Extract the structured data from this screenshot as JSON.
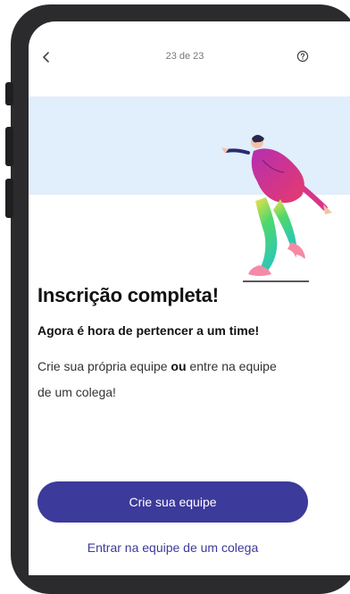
{
  "header": {
    "back_icon": "chevron-left-icon",
    "progress": "23 de 23",
    "help_icon": "question-circle-icon"
  },
  "content": {
    "title": "Inscrição completa!",
    "subtitle": "Agora é hora de pertencer a um time!",
    "body_part1": "Crie sua própria equipe ",
    "body_bold": "ou",
    "body_part2": " entre na equipe de um colega!"
  },
  "actions": {
    "primary_label": "Crie sua equipe",
    "secondary_label": "Entrar na equipe de um colega"
  },
  "colors": {
    "accent": "#3c3a9a",
    "hero_background": "#e1eefb",
    "frame": "#2b2b2d"
  }
}
